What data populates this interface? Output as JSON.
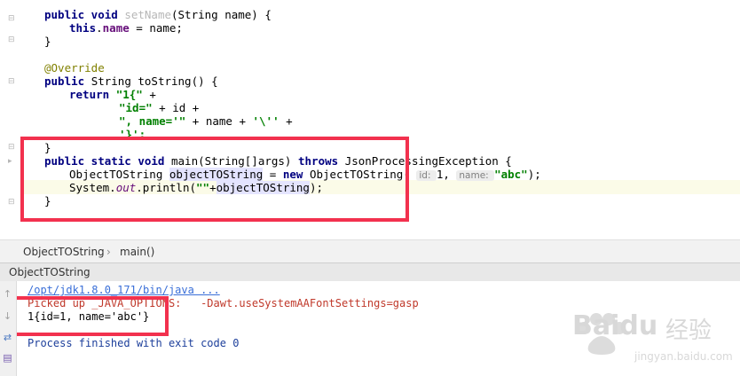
{
  "editor": {
    "lines": {
      "l1": {
        "kw": "public void ",
        "name": "setName",
        "rest": "(String name) {"
      },
      "l2": {
        "kw": "this",
        "dot": ".",
        "field": "name",
        "rest": " = name;"
      },
      "l3": "}",
      "l5": "@Override",
      "l6": {
        "kw": "public ",
        "rest": "String toString() {"
      },
      "l7": {
        "kw": "return ",
        "str": "\"1{\"",
        "rest": " +"
      },
      "l8": {
        "str": "\"id=\"",
        "rest": " + id +"
      },
      "l9": {
        "str": "\", name='\"",
        "rest": " + name + ",
        "str2": "'\\''",
        "rest2": " +"
      },
      "l10": {
        "str": "'}';"
      },
      "l11": "}",
      "l12": {
        "kw": "public static void ",
        "rest": "main(String[]args) ",
        "kw2": "throws ",
        "rest2": "JsonProcessingException {"
      },
      "l13": {
        "a": "ObjectTOString ",
        "var": "objectTOString",
        "b": " = ",
        "kw": "new ",
        "c": "ObjectTOString( ",
        "hint1": "id: ",
        "d": "1, ",
        "hint2": "name: ",
        "str": "\"abc\"",
        "e": ");"
      },
      "l14": {
        "a": "System.",
        "out": "out",
        "b": ".println(",
        "str": "\"\"",
        "c": "+",
        "var": "objectTOString",
        "d": ");"
      },
      "l15": "}"
    }
  },
  "breadcrumb": {
    "class": "ObjectTOString",
    "sep": "›",
    "method": "main()"
  },
  "run": {
    "tab": "ObjectTOString",
    "lines": {
      "cmd": "/opt/jdk1.8.0_171/bin/java ...",
      "picked": "Picked up _JAVA_OPTIONS:   -Dawt.useSystemAAFontSettings=gasp",
      "output": "1{id=1, name='abc'}",
      "exit": "Process finished with exit code 0"
    }
  },
  "icons": {
    "up": "arrow-up-icon",
    "down": "arrow-down-icon",
    "wrap": "soft-wrap-icon",
    "print": "print-icon"
  },
  "watermark": {
    "brand": "Baidu",
    "cn": "经验",
    "url": "jingyan.baidu.com"
  },
  "colors": {
    "keyword": "#000080",
    "string": "#008000",
    "field": "#660e7a",
    "box": "#f2314e",
    "console_error": "#c0392b"
  }
}
